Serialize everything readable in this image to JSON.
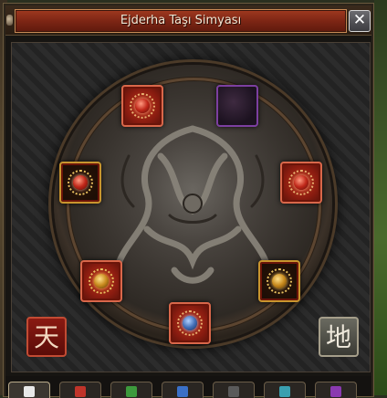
{
  "window": {
    "title": "Ejderha Taşı Simyası",
    "close_label": "✕"
  },
  "glyphs": {
    "heaven": "天",
    "earth": "地"
  },
  "slots": [
    {
      "name": "slot-top-left",
      "style": "red",
      "gem": "red"
    },
    {
      "name": "slot-top-right",
      "style": "purple",
      "gem": "none"
    },
    {
      "name": "slot-mid-left",
      "style": "gold-frame",
      "gem": "red"
    },
    {
      "name": "slot-mid-right",
      "style": "red",
      "gem": "red"
    },
    {
      "name": "slot-low-left",
      "style": "red",
      "gem": "gold"
    },
    {
      "name": "slot-low-right",
      "style": "gold-frame",
      "gem": "gold"
    },
    {
      "name": "slot-bottom",
      "style": "red",
      "gem": "blue"
    }
  ],
  "tabs": [
    {
      "name": "tab-1",
      "color": "#e8e8e8",
      "active": true
    },
    {
      "name": "tab-2",
      "color": "#c0342a",
      "active": false
    },
    {
      "name": "tab-3",
      "color": "#3d9a3d",
      "active": false
    },
    {
      "name": "tab-4",
      "color": "#3a70c8",
      "active": false
    },
    {
      "name": "tab-5",
      "color": "#5a5a5a",
      "active": false
    },
    {
      "name": "tab-6",
      "color": "#3aa0b0",
      "active": false
    },
    {
      "name": "tab-7",
      "color": "#8a3ab0",
      "active": false
    }
  ],
  "colors": {
    "title_bar": "#8a2a16",
    "slot_red": "#c2371d",
    "slot_purple": "#7c3fa0",
    "gold": "#c9952e"
  }
}
